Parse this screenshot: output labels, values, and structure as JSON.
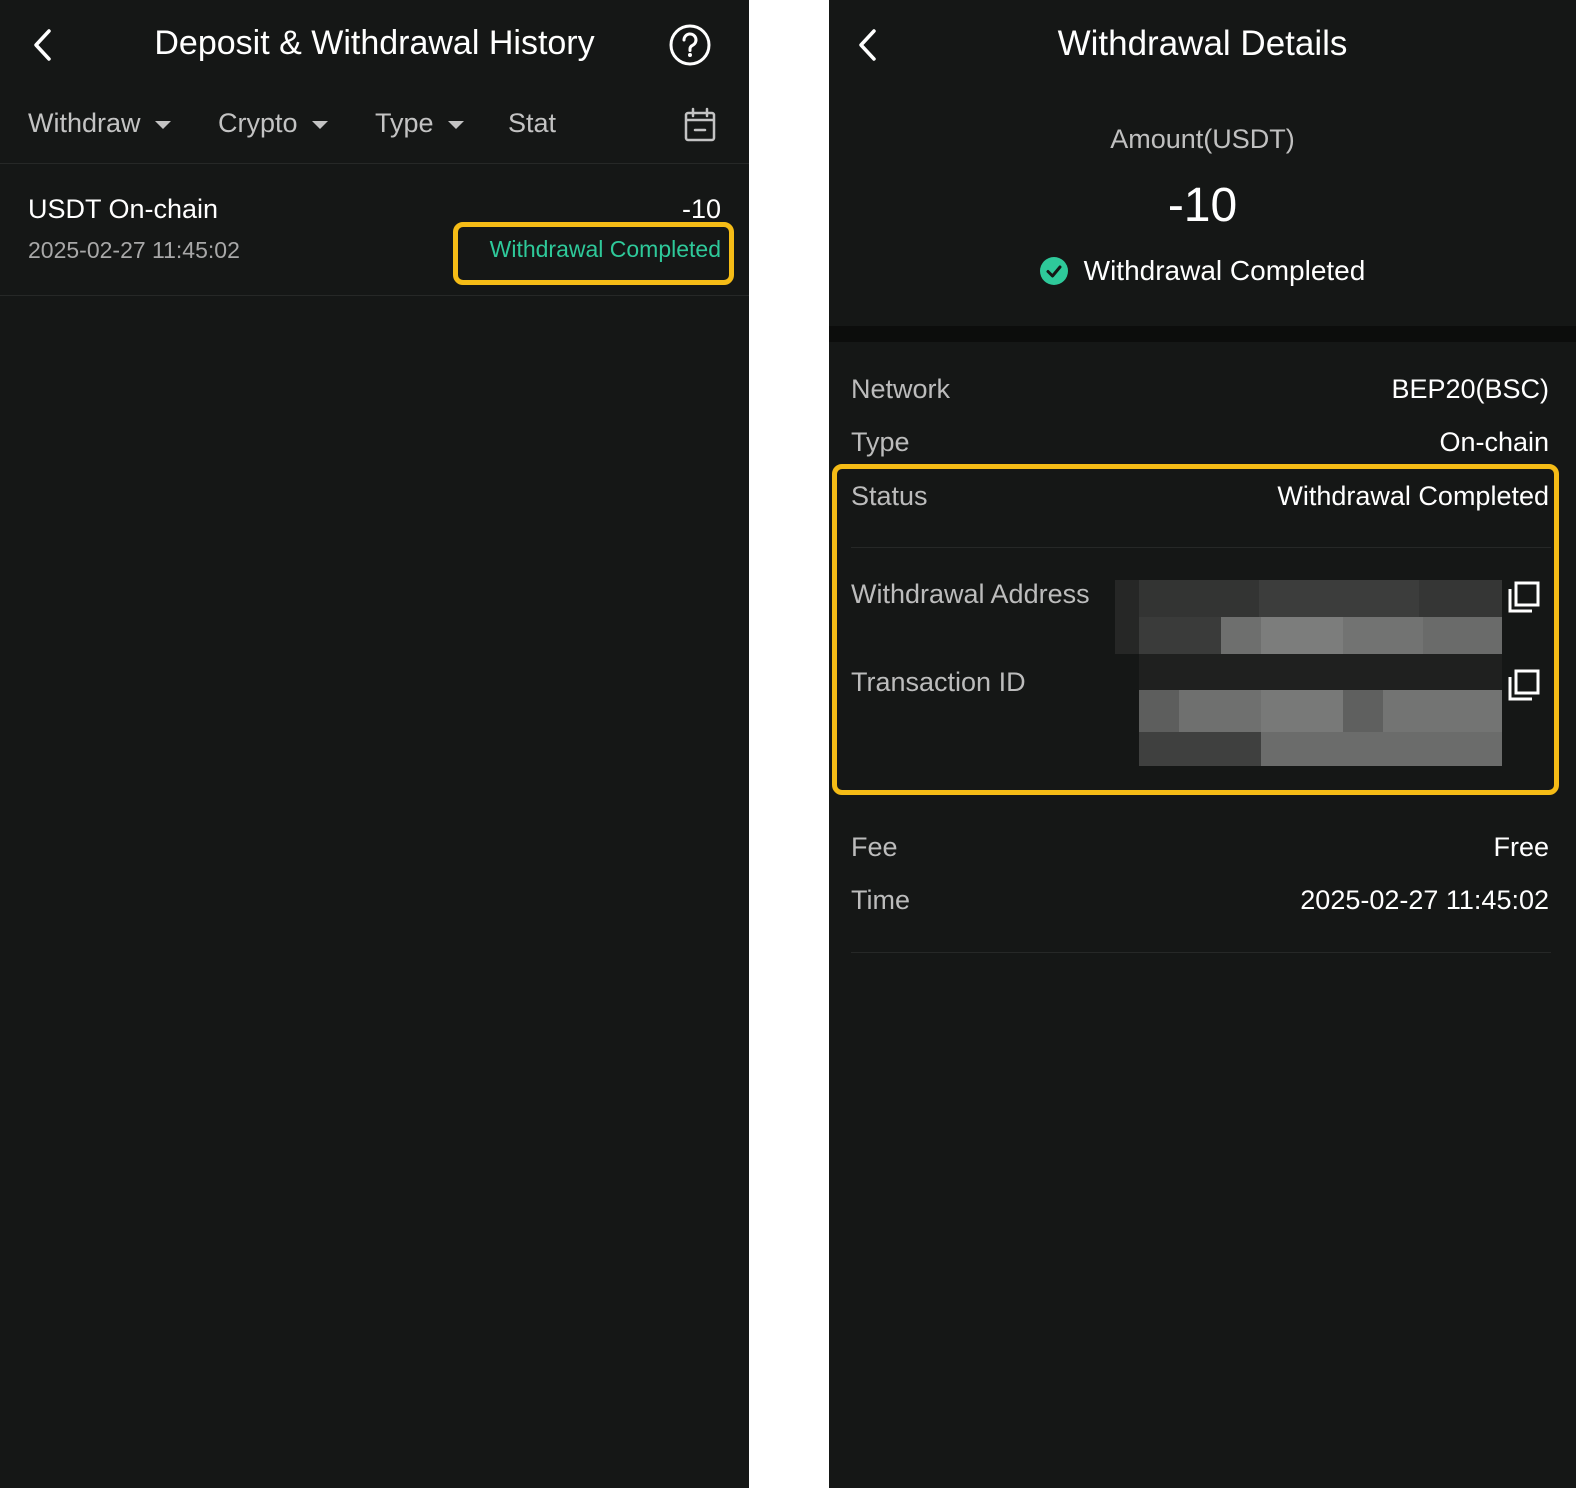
{
  "left": {
    "header": {
      "title": "Deposit & Withdrawal History",
      "back_icon": "chevron-left-icon",
      "help_icon": "question-circle-icon"
    },
    "filters": [
      {
        "label": "Withdraw"
      },
      {
        "label": "Crypto"
      },
      {
        "label": "Type"
      },
      {
        "label": "Stat"
      }
    ],
    "calendar_icon": "calendar-icon",
    "record": {
      "title": "USDT On-chain",
      "time": "2025-02-27 11:45:02",
      "amount": "-10",
      "status": "Withdrawal Completed"
    }
  },
  "right": {
    "header": {
      "title": "Withdrawal Details",
      "back_icon": "chevron-left-icon"
    },
    "amount_label": "Amount(USDT)",
    "amount_value": "-10",
    "status_text": "Withdrawal Completed",
    "details": {
      "network_label": "Network",
      "network_value": "BEP20(BSC)",
      "type_label": "Type",
      "type_value": "On-chain",
      "status_label": "Status",
      "status_value": "Withdrawal Completed",
      "address_label": "Withdrawal Address",
      "txid_label": "Transaction ID",
      "fee_label": "Fee",
      "fee_value": "Free",
      "time_label": "Time",
      "time_value": "2025-02-27 11:45:02"
    }
  },
  "colors": {
    "background": "#151716",
    "success_green": "#2ec99a",
    "highlight_yellow": "#f5bc16",
    "muted_text": "#bcbcbc"
  }
}
